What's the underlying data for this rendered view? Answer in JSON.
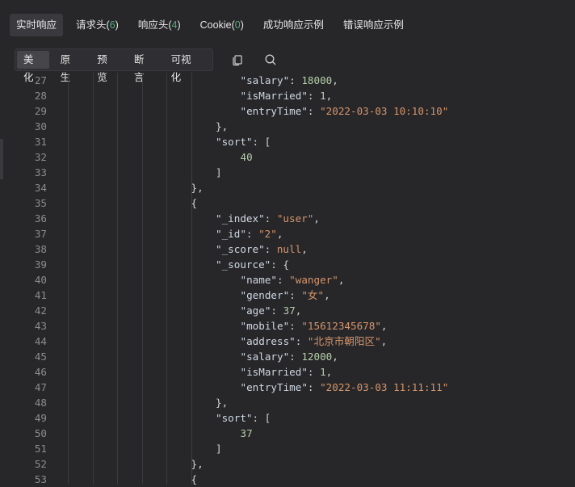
{
  "tabs": [
    {
      "label": "实时响应",
      "count": null,
      "active": true
    },
    {
      "label": "请求头",
      "count": "6",
      "active": false
    },
    {
      "label": "响应头",
      "count": "4",
      "active": false
    },
    {
      "label": "Cookie",
      "count": "0",
      "active": false
    },
    {
      "label": "成功响应示例",
      "count": null,
      "active": false
    },
    {
      "label": "错误响应示例",
      "count": null,
      "active": false
    }
  ],
  "views": [
    {
      "label": "美化",
      "active": true
    },
    {
      "label": "原生",
      "active": false
    },
    {
      "label": "预览",
      "active": false
    },
    {
      "label": "断言",
      "active": false
    },
    {
      "label": "可视化",
      "active": false
    }
  ],
  "icons": {
    "copy": "copy-icon",
    "search": "search-icon"
  },
  "code_lines": [
    {
      "n": 27,
      "indent": 7,
      "tokens": [
        [
          "k",
          "\"salary\""
        ],
        [
          "p",
          ": "
        ],
        [
          "n",
          "18000"
        ],
        [
          "p",
          ","
        ]
      ]
    },
    {
      "n": 28,
      "indent": 7,
      "tokens": [
        [
          "k",
          "\"isMarried\""
        ],
        [
          "p",
          ": "
        ],
        [
          "n",
          "1"
        ],
        [
          "p",
          ","
        ]
      ]
    },
    {
      "n": 29,
      "indent": 7,
      "tokens": [
        [
          "k",
          "\"entryTime\""
        ],
        [
          "p",
          ": "
        ],
        [
          "s",
          "\"2022-03-03 10:10:10\""
        ]
      ]
    },
    {
      "n": 30,
      "indent": 6,
      "tokens": [
        [
          "p",
          "},"
        ]
      ]
    },
    {
      "n": 31,
      "indent": 6,
      "tokens": [
        [
          "k",
          "\"sort\""
        ],
        [
          "p",
          ": ["
        ]
      ]
    },
    {
      "n": 32,
      "indent": 7,
      "tokens": [
        [
          "n",
          "40"
        ]
      ]
    },
    {
      "n": 33,
      "indent": 6,
      "tokens": [
        [
          "p",
          "]"
        ]
      ]
    },
    {
      "n": 34,
      "indent": 5,
      "tokens": [
        [
          "p",
          "},"
        ]
      ]
    },
    {
      "n": 35,
      "indent": 5,
      "tokens": [
        [
          "p",
          "{"
        ]
      ]
    },
    {
      "n": 36,
      "indent": 6,
      "tokens": [
        [
          "k",
          "\"_index\""
        ],
        [
          "p",
          ": "
        ],
        [
          "s",
          "\"user\""
        ],
        [
          "p",
          ","
        ]
      ]
    },
    {
      "n": 37,
      "indent": 6,
      "tokens": [
        [
          "k",
          "\"_id\""
        ],
        [
          "p",
          ": "
        ],
        [
          "s",
          "\"2\""
        ],
        [
          "p",
          ","
        ]
      ]
    },
    {
      "n": 38,
      "indent": 6,
      "tokens": [
        [
          "k",
          "\"_score\""
        ],
        [
          "p",
          ": "
        ],
        [
          "nl",
          "null"
        ],
        [
          "p",
          ","
        ]
      ]
    },
    {
      "n": 39,
      "indent": 6,
      "tokens": [
        [
          "k",
          "\"_source\""
        ],
        [
          "p",
          ": {"
        ]
      ]
    },
    {
      "n": 40,
      "indent": 7,
      "tokens": [
        [
          "k",
          "\"name\""
        ],
        [
          "p",
          ": "
        ],
        [
          "s",
          "\"wanger\""
        ],
        [
          "p",
          ","
        ]
      ]
    },
    {
      "n": 41,
      "indent": 7,
      "tokens": [
        [
          "k",
          "\"gender\""
        ],
        [
          "p",
          ": "
        ],
        [
          "s",
          "\"女\""
        ],
        [
          "p",
          ","
        ]
      ]
    },
    {
      "n": 42,
      "indent": 7,
      "tokens": [
        [
          "k",
          "\"age\""
        ],
        [
          "p",
          ": "
        ],
        [
          "n",
          "37"
        ],
        [
          "p",
          ","
        ]
      ]
    },
    {
      "n": 43,
      "indent": 7,
      "tokens": [
        [
          "k",
          "\"mobile\""
        ],
        [
          "p",
          ": "
        ],
        [
          "s",
          "\"15612345678\""
        ],
        [
          "p",
          ","
        ]
      ]
    },
    {
      "n": 44,
      "indent": 7,
      "tokens": [
        [
          "k",
          "\"address\""
        ],
        [
          "p",
          ": "
        ],
        [
          "s",
          "\"北京市朝阳区\""
        ],
        [
          "p",
          ","
        ]
      ]
    },
    {
      "n": 45,
      "indent": 7,
      "tokens": [
        [
          "k",
          "\"salary\""
        ],
        [
          "p",
          ": "
        ],
        [
          "n",
          "12000"
        ],
        [
          "p",
          ","
        ]
      ]
    },
    {
      "n": 46,
      "indent": 7,
      "tokens": [
        [
          "k",
          "\"isMarried\""
        ],
        [
          "p",
          ": "
        ],
        [
          "n",
          "1"
        ],
        [
          "p",
          ","
        ]
      ]
    },
    {
      "n": 47,
      "indent": 7,
      "tokens": [
        [
          "k",
          "\"entryTime\""
        ],
        [
          "p",
          ": "
        ],
        [
          "s",
          "\"2022-03-03 11:11:11\""
        ]
      ]
    },
    {
      "n": 48,
      "indent": 6,
      "tokens": [
        [
          "p",
          "},"
        ]
      ]
    },
    {
      "n": 49,
      "indent": 6,
      "tokens": [
        [
          "k",
          "\"sort\""
        ],
        [
          "p",
          ": ["
        ]
      ]
    },
    {
      "n": 50,
      "indent": 7,
      "tokens": [
        [
          "n",
          "37"
        ]
      ]
    },
    {
      "n": 51,
      "indent": 6,
      "tokens": [
        [
          "p",
          "]"
        ]
      ]
    },
    {
      "n": 52,
      "indent": 5,
      "tokens": [
        [
          "p",
          "},"
        ]
      ]
    },
    {
      "n": 53,
      "indent": 5,
      "tokens": [
        [
          "p",
          "{"
        ]
      ]
    }
  ]
}
